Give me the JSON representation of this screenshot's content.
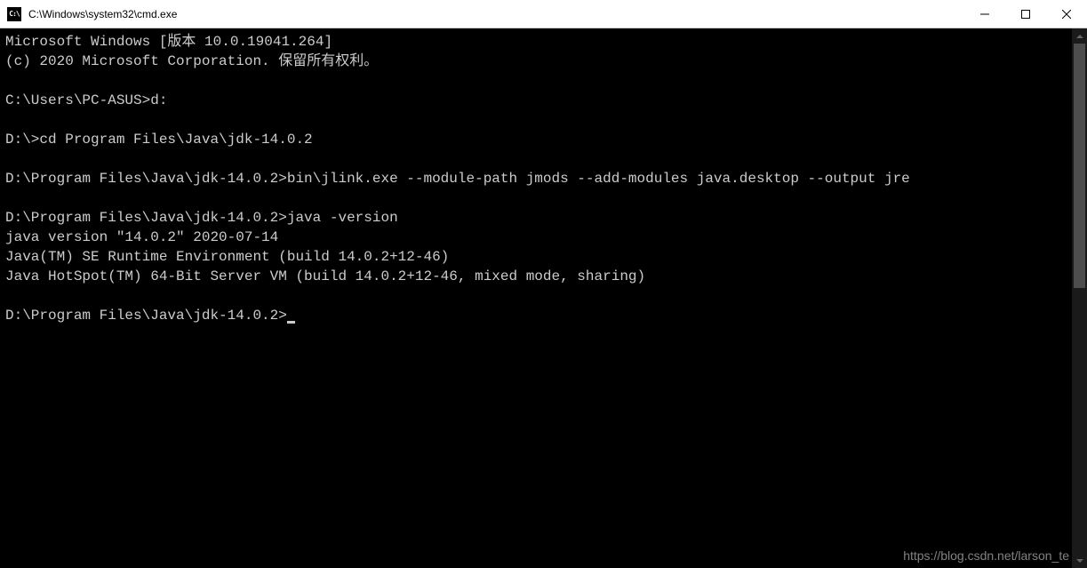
{
  "titlebar": {
    "icon_text": "C:\\",
    "title": "C:\\Windows\\system32\\cmd.exe"
  },
  "terminal": {
    "lines": [
      "Microsoft Windows [版本 10.0.19041.264]",
      "(c) 2020 Microsoft Corporation. 保留所有权利。",
      "",
      "C:\\Users\\PC-ASUS>d:",
      "",
      "D:\\>cd Program Files\\Java\\jdk-14.0.2",
      "",
      "D:\\Program Files\\Java\\jdk-14.0.2>bin\\jlink.exe --module-path jmods --add-modules java.desktop --output jre",
      "",
      "D:\\Program Files\\Java\\jdk-14.0.2>java -version",
      "java version \"14.0.2\" 2020-07-14",
      "Java(TM) SE Runtime Environment (build 14.0.2+12-46)",
      "Java HotSpot(TM) 64-Bit Server VM (build 14.0.2+12-46, mixed mode, sharing)",
      "",
      "D:\\Program Files\\Java\\jdk-14.0.2>"
    ]
  },
  "watermark": "https://blog.csdn.net/larson_te"
}
